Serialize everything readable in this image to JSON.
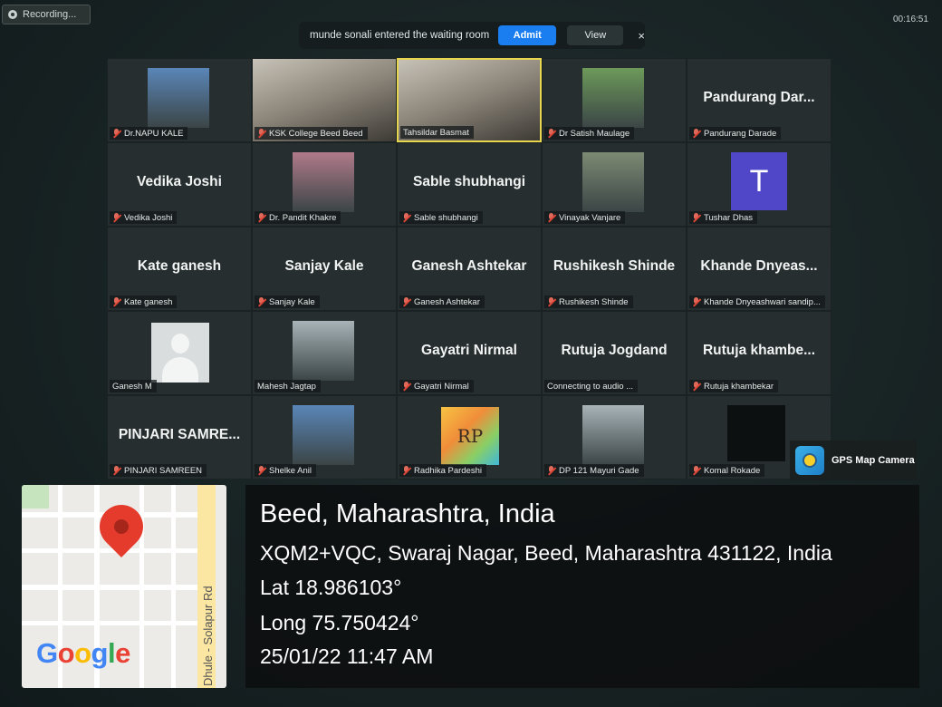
{
  "recording_label": "Recording...",
  "meeting_timer": "00:16:51",
  "waiting_room": {
    "message": "munde sonali entered the waiting room",
    "admit_label": "Admit",
    "view_label": "View",
    "close_glyph": "×"
  },
  "participants": [
    {
      "label": "Dr.NAPU KALE",
      "type": "photo",
      "muted": true
    },
    {
      "label": "KSK College Beed Beed",
      "type": "video",
      "muted": true
    },
    {
      "label": "Tahsildar Basmat",
      "type": "video",
      "muted": false,
      "active_speaker": true
    },
    {
      "label": "Dr Satish Maulage",
      "type": "photo",
      "muted": true
    },
    {
      "label": "Pandurang Darade",
      "display_name": "Pandurang  Dar...",
      "type": "name",
      "muted": true
    },
    {
      "label": "Vedika Joshi",
      "display_name": "Vedika Joshi",
      "type": "name",
      "muted": true
    },
    {
      "label": "Dr. Pandit Khakre",
      "type": "photo",
      "muted": true
    },
    {
      "label": "Sable shubhangi",
      "display_name": "Sable shubhangi",
      "type": "name",
      "muted": true
    },
    {
      "label": "Vinayak Vanjare",
      "type": "photo",
      "muted": true
    },
    {
      "label": "Tushar Dhas",
      "type": "avatar",
      "avatar_letter": "T",
      "muted": true
    },
    {
      "label": "Kate ganesh",
      "display_name": "Kate ganesh",
      "type": "name",
      "muted": true
    },
    {
      "label": "Sanjay Kale",
      "display_name": "Sanjay Kale",
      "type": "name",
      "muted": true
    },
    {
      "label": "Ganesh Ashtekar",
      "display_name": "Ganesh Ashtekar",
      "type": "name",
      "muted": true
    },
    {
      "label": "Rushikesh Shinde",
      "display_name": "Rushikesh Shinde",
      "type": "name",
      "muted": true
    },
    {
      "label": "Khande Dnyeashwari sandip...",
      "display_name": "Khande  Dnyeas...",
      "type": "name",
      "muted": true
    },
    {
      "label": "Ganesh M",
      "type": "blank",
      "muted": false
    },
    {
      "label": "Mahesh Jagtap",
      "type": "photo",
      "muted": false
    },
    {
      "label": "Gayatri Nirmal",
      "display_name": "Gayatri Nirmal",
      "type": "name",
      "muted": true
    },
    {
      "label": "Connecting to audio ...",
      "display_name": "Rutuja Jogdand",
      "type": "name",
      "muted": false
    },
    {
      "label": "Rutuja khambekar",
      "display_name": "Rutuja  khambe...",
      "type": "name",
      "muted": true
    },
    {
      "label": "PINJARI SAMREEN",
      "display_name": "PINJARI  SAMRE...",
      "type": "name",
      "muted": true
    },
    {
      "label": "Shelke Anil",
      "type": "photo",
      "muted": true
    },
    {
      "label": "Radhika Pardeshi",
      "type": "logo",
      "logo_text": "RP",
      "muted": true
    },
    {
      "label": "DP 121 Mayuri Gade",
      "type": "photo",
      "muted": true
    },
    {
      "label": "Komal Rokade",
      "type": "dark",
      "muted": true
    }
  ],
  "gps_overlay": {
    "app_name": "GPS Map Camera",
    "location": "Beed, Maharashtra, India",
    "address": "XQM2+VQC, Swaraj Nagar, Beed, Maharashtra 431122, India",
    "latitude": "Lat 18.986103°",
    "longitude": "Long 75.750424°",
    "datetime": "25/01/22 11:47 AM",
    "map_road_label": "Dhule - Solapur Rd",
    "map_brand": "Google"
  }
}
